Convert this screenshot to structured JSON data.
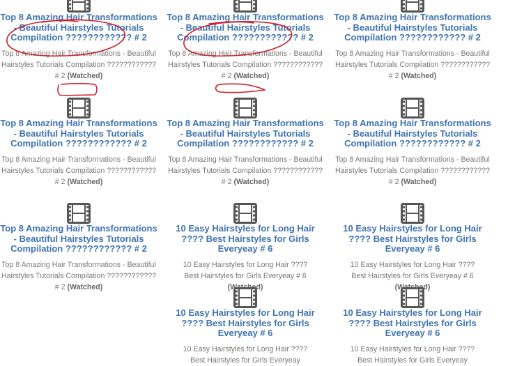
{
  "videos": [
    {
      "title": "Top 8 Amazing Hair Transformations - Beautiful Hairstyles Tutorials Compilation ???????????? # 2",
      "description": "Top 8 Amazing Hair Transformations - Beautiful Hairstyles Tutorials Compilation ???????????? # 2",
      "status": "(Watched)",
      "icon": "film-icon"
    },
    {
      "title": "Top 8 Amazing Hair Transformations - Beautiful Hairstyles Tutorials Compilation ???????????? # 2",
      "description": "Top 8 Amazing Hair Transformations - Beautiful Hairstyles Tutorials Compilation ???????????? # 2",
      "status": "(Watched)",
      "icon": "film-icon"
    },
    {
      "title": "Top 8 Amazing Hair Transformations - Beautiful Hairstyles Tutorials Compilation ???????????? # 2",
      "description": "Top 8 Amazing Hair Transformations - Beautiful Hairstyles Tutorials Compilation ???????????? # 2",
      "status": "(Watched)",
      "icon": "film-icon"
    },
    {
      "title": "Top 8 Amazing Hair Transformations - Beautiful Hairstyles Tutorials Compilation ???????????? # 2",
      "description": "Top 8 Amazing Hair Transformations - Beautiful Hairstyles Tutorials Compilation ???????????? # 2",
      "status": "(Watched)",
      "icon": "film-icon"
    },
    {
      "title": "Top 8 Amazing Hair Transformations - Beautiful Hairstyles Tutorials Compilation ???????????? # 2",
      "description": "Top 8 Amazing Hair Transformations - Beautiful Hairstyles Tutorials Compilation ???????????? # 2",
      "status": "(Watched)",
      "icon": "film-icon"
    },
    {
      "title": "Top 8 Amazing Hair Transformations - Beautiful Hairstyles Tutorials Compilation ???????????? # 2",
      "description": "Top 8 Amazing Hair Transformations - Beautiful Hairstyles Tutorials Compilation ???????????? # 2",
      "status": "(Watched)",
      "icon": "film-icon"
    },
    {
      "title": "Top 8 Amazing Hair Transformations - Beautiful Hairstyles Tutorials Compilation ???????????? # 2",
      "description": "Top 8 Amazing Hair Transformations - Beautiful Hairstyles Tutorials Compilation ???????????? # 2",
      "status": "(Watched)",
      "icon": "film-icon"
    },
    {
      "title": "10 Easy Hairstyles for Long Hair ???? Best Hairstyles for Girls Everyeay # 6",
      "description": "10 Easy Hairstyles for Long Hair ???? Best Hairstyles for Girls Everyeay # 6",
      "status": "(Watched)",
      "icon": "film-icon"
    },
    {
      "title": "10 Easy Hairstyles for Long Hair ???? Best Hairstyles for Girls Everyeay # 6",
      "description": "10 Easy Hairstyles for Long Hair ???? Best Hairstyles for Girls Everyeay # 6",
      "status": "(Watched)",
      "icon": "film-icon"
    },
    {
      "title": "10 Easy Hairstyles for Long Hair ???? Best Hairstyles for Girls Everyeay # 6",
      "description": "10 Easy Hairstyles for Long Hair ???? Best Hairstyles for Girls Everyeay",
      "status": "",
      "icon": "film-icon"
    },
    {
      "title": "10 Easy Hairstyles for Long Hair ???? Best Hairstyles for Girls Everyeay # 6",
      "description": "10 Easy Hairstyles for Long Hair ???? Best Hairstyles for Girls Everyeay",
      "status": "",
      "icon": "film-icon"
    }
  ],
  "colors": {
    "title_link": "#3f73b0",
    "description": "#777777",
    "icon": "#555555",
    "annotation": "#cc1f2a"
  }
}
